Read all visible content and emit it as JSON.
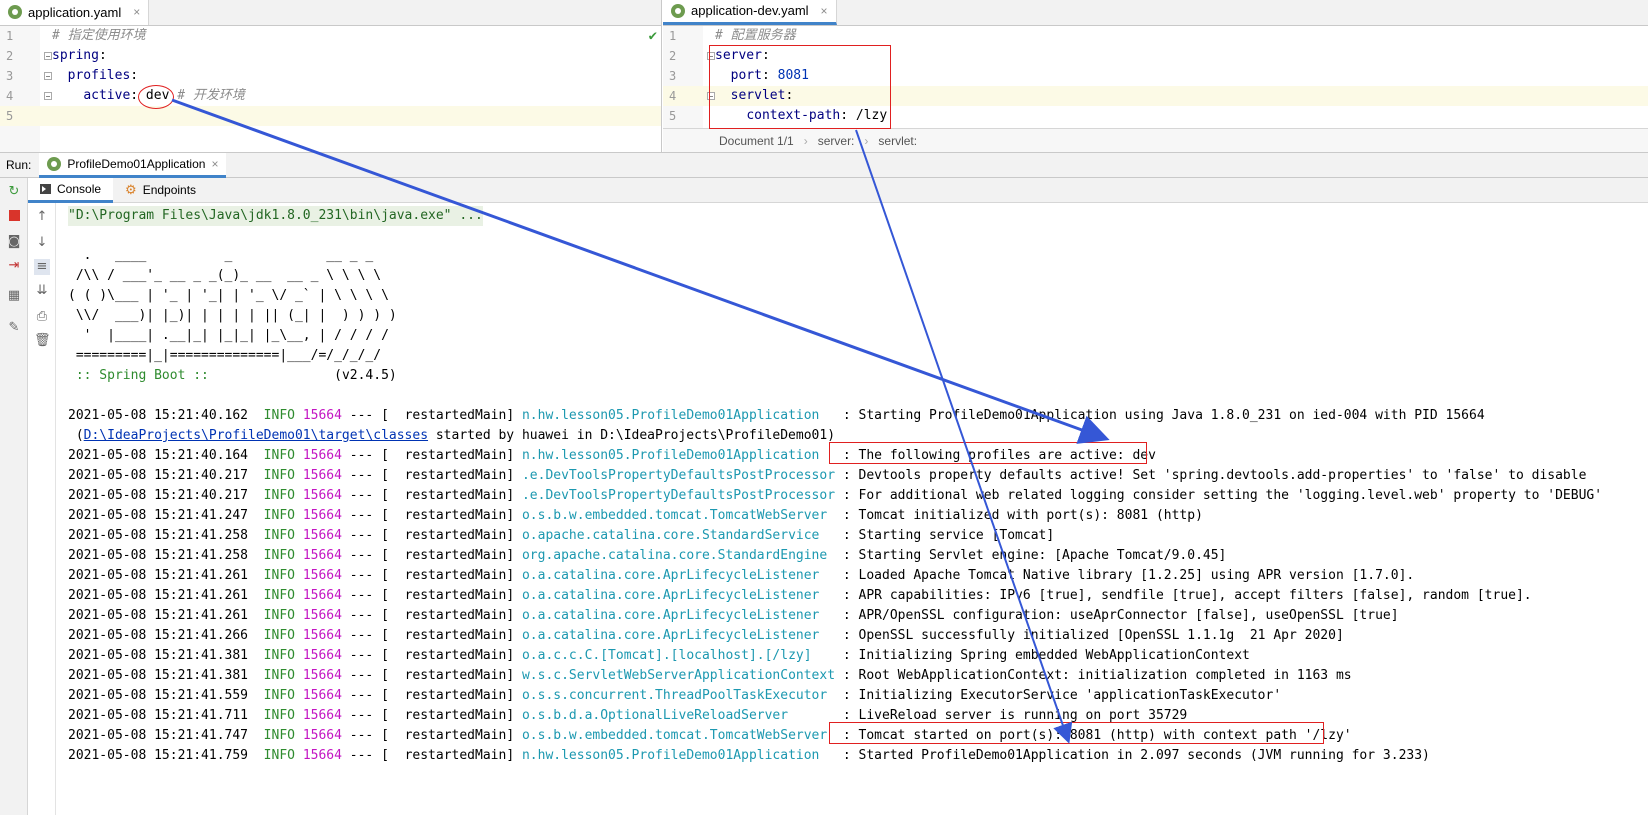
{
  "left_editor": {
    "tab_label": "application.yaml",
    "tab_close": "×",
    "lines": [
      {
        "num": "1",
        "parts": [
          {
            "cls": "cm",
            "t": "# 指定使用环境"
          }
        ]
      },
      {
        "num": "2",
        "parts": [
          {
            "cls": "k",
            "t": "spring"
          },
          {
            "cls": "plain",
            "t": ":"
          }
        ]
      },
      {
        "num": "3",
        "parts": [
          {
            "cls": "plain",
            "t": "  "
          },
          {
            "cls": "k",
            "t": "profiles"
          },
          {
            "cls": "plain",
            "t": ":"
          }
        ]
      },
      {
        "num": "4",
        "parts": [
          {
            "cls": "plain",
            "t": "    "
          },
          {
            "cls": "k",
            "t": "active"
          },
          {
            "cls": "plain",
            "t": ": dev "
          },
          {
            "cls": "cm",
            "t": "# 开发环境"
          }
        ]
      },
      {
        "num": "5",
        "parts": []
      }
    ],
    "check": "✔"
  },
  "right_editor": {
    "tab_label": "application-dev.yaml",
    "tab_close": "×",
    "lines": [
      {
        "num": "1",
        "parts": [
          {
            "cls": "cm",
            "t": "# 配置服务器"
          }
        ]
      },
      {
        "num": "2",
        "parts": [
          {
            "cls": "k",
            "t": "server"
          },
          {
            "cls": "plain",
            "t": ":"
          }
        ]
      },
      {
        "num": "3",
        "parts": [
          {
            "cls": "plain",
            "t": "  "
          },
          {
            "cls": "k",
            "t": "port"
          },
          {
            "cls": "plain",
            "t": ": "
          },
          {
            "cls": "v",
            "t": "8081"
          }
        ]
      },
      {
        "num": "4",
        "parts": [
          {
            "cls": "plain",
            "t": "  "
          },
          {
            "cls": "k",
            "t": "servlet"
          },
          {
            "cls": "plain",
            "t": ":"
          }
        ]
      },
      {
        "num": "5",
        "parts": [
          {
            "cls": "plain",
            "t": "    "
          },
          {
            "cls": "k",
            "t": "context-path"
          },
          {
            "cls": "plain",
            "t": ": /lzy"
          }
        ]
      }
    ],
    "breadcrumb": [
      "Document 1/1",
      "server:",
      "servlet:"
    ],
    "breadcrumb_sep": "›"
  },
  "run_bar": {
    "label": "Run:",
    "config": "ProfileDemo01Application",
    "close": "×"
  },
  "console_tabs": [
    "Console",
    "Endpoints"
  ],
  "console": {
    "command": "\"D:\\Program Files\\Java\\jdk1.8.0_231\\bin\\java.exe\" ...",
    "banner": [
      "  .   ____          _            __ _ _",
      " /\\\\ / ___'_ __ _ _(_)_ __  __ _ \\ \\ \\ \\",
      "( ( )\\___ | '_ | '_| | '_ \\/ _` | \\ \\ \\ \\",
      " \\\\/  ___)| |_)| | | | | || (_| |  ) ) ) )",
      "  '  |____| .__|_| |_|_| |_\\__, | / / / /",
      " =========|_|==============|___/=/_/_/_/"
    ],
    "spring_boot_label": " :: Spring Boot :: ",
    "spring_boot_version": "               (v2.4.5)",
    "logs": [
      {
        "ts": "2021-05-08 15:21:40.162",
        "lvl": "INFO",
        "pid": "15664",
        "thr": " --- [  restartedMain] ",
        "logger": "n.hw.lesson05.ProfileDemo01Application  ",
        "msg": " : Starting ProfileDemo01Application using Java 1.8.0_231 on ied-004 with PID 15664"
      },
      {
        "cont": true,
        "pre": " (",
        "link": "D:\\IdeaProjects\\ProfileDemo01\\target\\classes",
        "msg": " started by huawei in D:\\IdeaProjects\\ProfileDemo01)"
      },
      {
        "ts": "2021-05-08 15:21:40.164",
        "lvl": "INFO",
        "pid": "15664",
        "thr": " --- [  restartedMain] ",
        "logger": "n.hw.lesson05.ProfileDemo01Application  ",
        "msg": " : The following profiles are active: dev"
      },
      {
        "ts": "2021-05-08 15:21:40.217",
        "lvl": "INFO",
        "pid": "15664",
        "thr": " --- [  restartedMain] ",
        "logger": ".e.DevToolsPropertyDefaultsPostProcessor",
        "msg": " : Devtools property defaults active! Set 'spring.devtools.add-properties' to 'false' to disable"
      },
      {
        "ts": "2021-05-08 15:21:40.217",
        "lvl": "INFO",
        "pid": "15664",
        "thr": " --- [  restartedMain] ",
        "logger": ".e.DevToolsPropertyDefaultsPostProcessor",
        "msg": " : For additional web related logging consider setting the 'logging.level.web' property to 'DEBUG'"
      },
      {
        "ts": "2021-05-08 15:21:41.247",
        "lvl": "INFO",
        "pid": "15664",
        "thr": " --- [  restartedMain] ",
        "logger": "o.s.b.w.embedded.tomcat.TomcatWebServer ",
        "msg": " : Tomcat initialized with port(s): 8081 (http)"
      },
      {
        "ts": "2021-05-08 15:21:41.258",
        "lvl": "INFO",
        "pid": "15664",
        "thr": " --- [  restartedMain] ",
        "logger": "o.apache.catalina.core.StandardService  ",
        "msg": " : Starting service [Tomcat]"
      },
      {
        "ts": "2021-05-08 15:21:41.258",
        "lvl": "INFO",
        "pid": "15664",
        "thr": " --- [  restartedMain] ",
        "logger": "org.apache.catalina.core.StandardEngine ",
        "msg": " : Starting Servlet engine: [Apache Tomcat/9.0.45]"
      },
      {
        "ts": "2021-05-08 15:21:41.261",
        "lvl": "INFO",
        "pid": "15664",
        "thr": " --- [  restartedMain] ",
        "logger": "o.a.catalina.core.AprLifecycleListener  ",
        "msg": " : Loaded Apache Tomcat Native library [1.2.25] using APR version [1.7.0]."
      },
      {
        "ts": "2021-05-08 15:21:41.261",
        "lvl": "INFO",
        "pid": "15664",
        "thr": " --- [  restartedMain] ",
        "logger": "o.a.catalina.core.AprLifecycleListener  ",
        "msg": " : APR capabilities: IPv6 [true], sendfile [true], accept filters [false], random [true]."
      },
      {
        "ts": "2021-05-08 15:21:41.261",
        "lvl": "INFO",
        "pid": "15664",
        "thr": " --- [  restartedMain] ",
        "logger": "o.a.catalina.core.AprLifecycleListener  ",
        "msg": " : APR/OpenSSL configuration: useAprConnector [false], useOpenSSL [true]"
      },
      {
        "ts": "2021-05-08 15:21:41.266",
        "lvl": "INFO",
        "pid": "15664",
        "thr": " --- [  restartedMain] ",
        "logger": "o.a.catalina.core.AprLifecycleListener  ",
        "msg": " : OpenSSL successfully initialized [OpenSSL 1.1.1g  21 Apr 2020]"
      },
      {
        "ts": "2021-05-08 15:21:41.381",
        "lvl": "INFO",
        "pid": "15664",
        "thr": " --- [  restartedMain] ",
        "logger": "o.a.c.c.C.[Tomcat].[localhost].[/lzy]   ",
        "msg": " : Initializing Spring embedded WebApplicationContext"
      },
      {
        "ts": "2021-05-08 15:21:41.381",
        "lvl": "INFO",
        "pid": "15664",
        "thr": " --- [  restartedMain] ",
        "logger": "w.s.c.ServletWebServerApplicationContext",
        "msg": " : Root WebApplicationContext: initialization completed in 1163 ms"
      },
      {
        "ts": "2021-05-08 15:21:41.559",
        "lvl": "INFO",
        "pid": "15664",
        "thr": " --- [  restartedMain] ",
        "logger": "o.s.s.concurrent.ThreadPoolTaskExecutor ",
        "msg": " : Initializing ExecutorService 'applicationTaskExecutor'"
      },
      {
        "ts": "2021-05-08 15:21:41.711",
        "lvl": "INFO",
        "pid": "15664",
        "thr": " --- [  restartedMain] ",
        "logger": "o.s.b.d.a.OptionalLiveReloadServer      ",
        "msg": " : LiveReload server is running on port 35729"
      },
      {
        "ts": "2021-05-08 15:21:41.747",
        "lvl": "INFO",
        "pid": "15664",
        "thr": " --- [  restartedMain] ",
        "logger": "o.s.b.w.embedded.tomcat.TomcatWebServer ",
        "msg": " : Tomcat started on port(s): 8081 (http) with context path '/lzy'"
      },
      {
        "ts": "2021-05-08 15:21:41.759",
        "lvl": "INFO",
        "pid": "15664",
        "thr": " --- [  restartedMain] ",
        "logger": "n.hw.lesson05.ProfileDemo01Application  ",
        "msg": " : Started ProfileDemo01Application in 2.097 seconds (JVM running for 3.233)"
      }
    ]
  },
  "colors": {
    "accent": "#4083c9",
    "highlight": "#e02020",
    "arrow": "#3557d6"
  }
}
